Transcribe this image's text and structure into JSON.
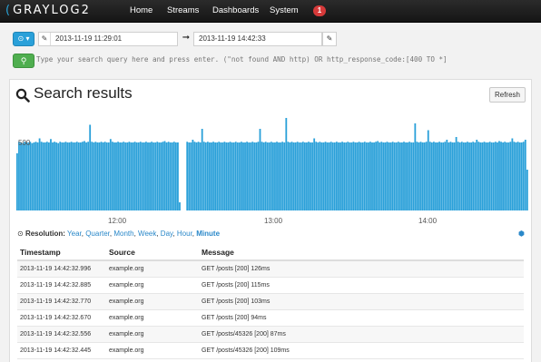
{
  "navbar": {
    "brand": "GRAYLOG2",
    "links": [
      "Home",
      "Streams",
      "Dashboards",
      "System"
    ],
    "notification_count": "1"
  },
  "time_range": {
    "from": "2013-11-19 11:29:01",
    "to": "2013-11-19 14:42:33"
  },
  "search": {
    "placeholder": "Type your search query here and press enter. (\"not found AND http) OR http_response_code:[400 TO *]"
  },
  "results": {
    "title": "Search results",
    "refresh_label": "Refresh"
  },
  "chart_data": {
    "type": "bar",
    "ylabel": "",
    "xlabel": "",
    "y_tick": "500",
    "x_ticks": [
      "12:00",
      "13:00",
      "14:00"
    ],
    "bar_color": "#2aa0d9",
    "values": [
      420,
      505,
      500,
      495,
      505,
      500,
      500,
      505,
      495,
      500,
      505,
      500,
      530,
      505,
      500,
      500,
      505,
      500,
      525,
      500,
      505,
      500,
      495,
      505,
      500,
      500,
      505,
      500,
      500,
      505,
      500,
      500,
      505,
      500,
      500,
      505,
      510,
      500,
      505,
      630,
      505,
      500,
      505,
      500,
      500,
      505,
      500,
      505,
      500,
      500,
      525,
      505,
      500,
      500,
      505,
      500,
      500,
      505,
      500,
      500,
      505,
      500,
      500,
      505,
      500,
      500,
      505,
      500,
      500,
      505,
      500,
      500,
      505,
      500,
      500,
      505,
      500,
      500,
      505,
      510,
      500,
      505,
      500,
      500,
      505,
      500,
      500,
      60,
      0,
      0,
      0,
      505,
      500,
      500,
      520,
      505,
      500,
      505,
      500,
      600,
      505,
      500,
      505,
      500,
      500,
      505,
      500,
      500,
      505,
      500,
      500,
      505,
      500,
      500,
      505,
      500,
      500,
      505,
      500,
      500,
      505,
      500,
      500,
      505,
      500,
      500,
      505,
      500,
      500,
      505,
      600,
      505,
      500,
      505,
      500,
      500,
      505,
      500,
      500,
      505,
      500,
      500,
      505,
      500,
      680,
      505,
      500,
      505,
      500,
      500,
      505,
      500,
      500,
      505,
      500,
      500,
      505,
      500,
      500,
      530,
      505,
      500,
      505,
      500,
      500,
      505,
      500,
      500,
      505,
      500,
      500,
      505,
      500,
      500,
      505,
      500,
      500,
      505,
      500,
      500,
      505,
      500,
      500,
      505,
      500,
      500,
      505,
      500,
      500,
      505,
      500,
      500,
      505,
      510,
      500,
      505,
      500,
      500,
      505,
      500,
      500,
      505,
      500,
      500,
      505,
      500,
      500,
      505,
      500,
      500,
      505,
      500,
      500,
      640,
      505,
      500,
      505,
      500,
      500,
      505,
      590,
      505,
      500,
      505,
      500,
      500,
      505,
      500,
      500,
      505,
      520,
      500,
      505,
      500,
      500,
      540,
      505,
      500,
      505,
      500,
      500,
      505,
      500,
      500,
      505,
      500,
      520,
      505,
      500,
      500,
      505,
      500,
      500,
      505,
      500,
      500,
      505,
      500,
      510,
      505,
      500,
      505,
      500,
      500,
      505,
      530,
      505,
      500,
      505,
      500,
      500,
      505,
      520,
      300
    ],
    "ylim": [
      0,
      720
    ]
  },
  "resolution": {
    "label": "Resolution:",
    "options": [
      "Year",
      "Quarter",
      "Month",
      "Week",
      "Day",
      "Hour",
      "Minute"
    ],
    "active": "Minute"
  },
  "table": {
    "headers": [
      "Timestamp",
      "Source",
      "Message"
    ],
    "rows": [
      [
        "2013-11-19 14:42:32.996",
        "example.org",
        "GET /posts [200] 126ms"
      ],
      [
        "2013-11-19 14:42:32.885",
        "example.org",
        "GET /posts [200] 115ms"
      ],
      [
        "2013-11-19 14:42:32.770",
        "example.org",
        "GET /posts [200] 103ms"
      ],
      [
        "2013-11-19 14:42:32.670",
        "example.org",
        "GET /posts [200] 94ms"
      ],
      [
        "2013-11-19 14:42:32.556",
        "example.org",
        "GET /posts/45326 [200] 87ms"
      ],
      [
        "2013-11-19 14:42:32.445",
        "example.org",
        "GET /posts/45326 [200] 109ms"
      ]
    ]
  }
}
